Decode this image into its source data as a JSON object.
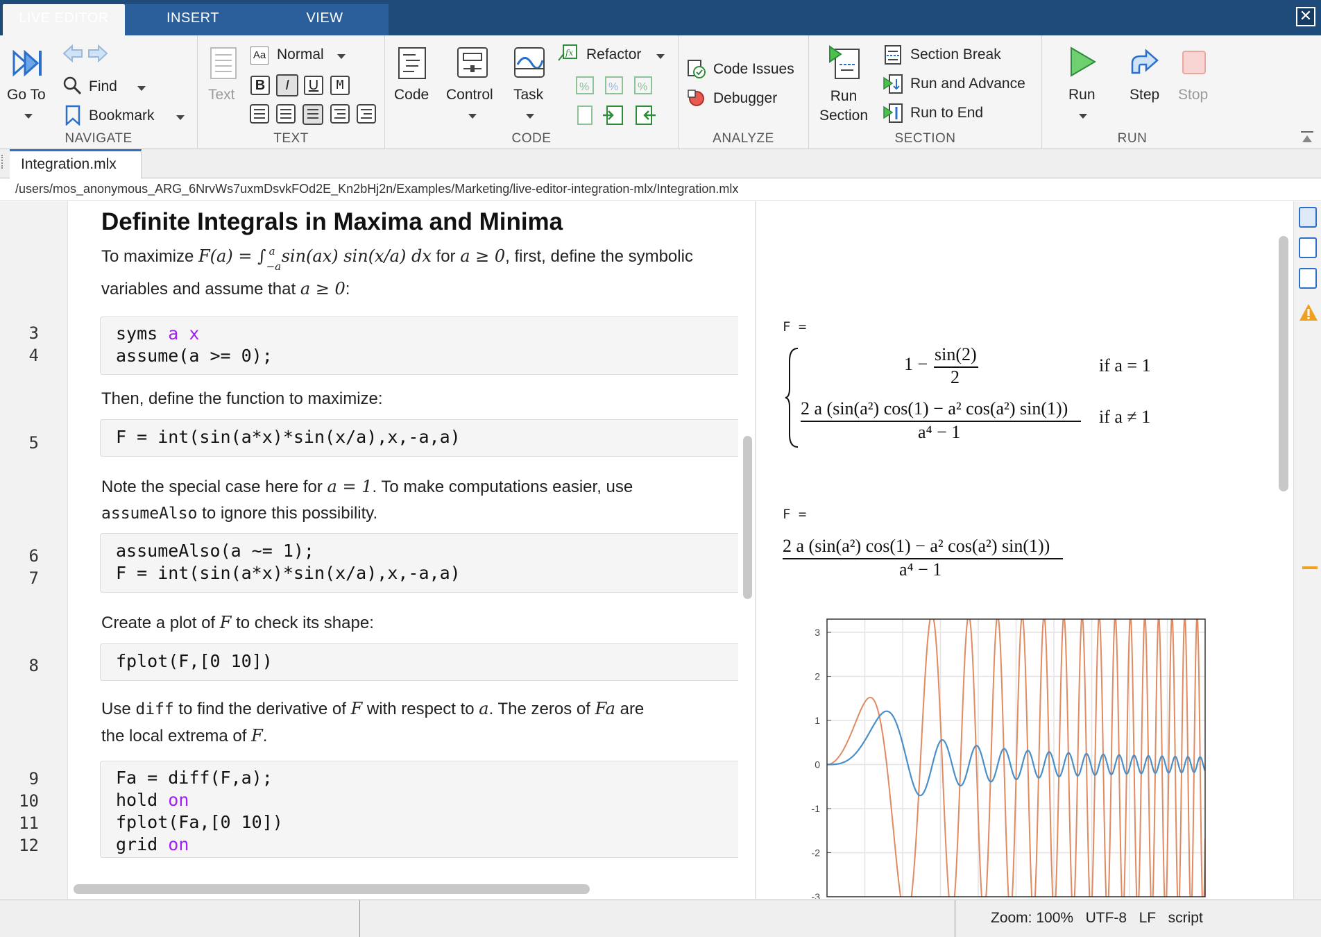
{
  "tabs": {
    "live_editor": "LIVE EDITOR",
    "insert": "INSERT",
    "view": "VIEW"
  },
  "ribbon": {
    "navigate": {
      "title": "NAVIGATE",
      "goto": "Go To",
      "find": "Find",
      "bookmark": "Bookmark"
    },
    "text": {
      "title": "TEXT",
      "text_btn": "Text",
      "style": "Normal",
      "bold": "B",
      "italic": "I",
      "underline": "U",
      "mono": "M"
    },
    "code": {
      "title": "CODE",
      "code_btn": "Code",
      "control": "Control",
      "task": "Task",
      "refactor": "Refactor"
    },
    "analyze": {
      "title": "ANALYZE",
      "code_issues": "Code Issues",
      "debugger": "Debugger"
    },
    "section": {
      "title": "SECTION",
      "run_section_1": "Run",
      "run_section_2": "Section",
      "section_break": "Section Break",
      "run_advance": "Run and Advance",
      "run_to_end": "Run to End"
    },
    "run": {
      "title": "RUN",
      "run": "Run",
      "step": "Step",
      "stop": "Stop"
    }
  },
  "document": {
    "tab_name": "Integration.mlx",
    "path": "/users/mos_anonymous_ARG_6NrvWs7uxmDsvkFOd2E_Kn2bHj2n/Examples/Marketing/live-editor-integration-mlx/Integration.mlx"
  },
  "editor": {
    "heading": "Definite Integrals in Maxima and Minima",
    "p1_a": "To maximize ",
    "p1_math1": "F(a) = ∫",
    "p1_sup": "a",
    "p1_sub": "−a",
    "p1_math2": "sin(ax) sin(x/a) dx",
    "p1_b": " for ",
    "p1_math3": "a ≥ 0",
    "p1_c": ", first, define the symbolic",
    "p1_line2": "variables and assume that ",
    "p1_math4": "a ≥ 0",
    "p1_end": ":",
    "p2": "Then, define the function to maximize:",
    "p3_a": "Note the special case here for ",
    "p3_math": "a = 1",
    "p3_b": ". To make computations easier, use",
    "p3_code": "assumeAlso",
    "p3_c": " to ignore this possibility.",
    "p4_a": "Create a plot of ",
    "p4_math": "F",
    "p4_b": " to check its shape:",
    "p5_a": "Use ",
    "p5_code": "diff",
    "p5_b": " to find the derivative of ",
    "p5_math1": "F",
    "p5_c": " with respect to ",
    "p5_math2": "a",
    "p5_d": ". The zeros of ",
    "p5_math3": "Fa",
    "p5_e": " are",
    "p5_line2": "the local extrema of ",
    "p5_math4": "F",
    "p5_end": ".",
    "blocks": [
      {
        "lines": [
          {
            "n": "3",
            "plain": "syms ",
            "kw": "a x"
          },
          {
            "n": "4",
            "plain": "assume(a >= 0);",
            "kw": ""
          }
        ]
      },
      {
        "lines": [
          {
            "n": "5",
            "plain": "F = int(sin(a*x)*sin(x/a),x,-a,a)",
            "kw": ""
          }
        ]
      },
      {
        "lines": [
          {
            "n": "6",
            "plain": "assumeAlso(a ~= 1);",
            "kw": ""
          },
          {
            "n": "7",
            "plain": "F = int(sin(a*x)*sin(x/a),x,-a,a)",
            "kw": ""
          }
        ]
      },
      {
        "lines": [
          {
            "n": "8",
            "plain": "fplot(F,[0 10])",
            "kw": ""
          }
        ]
      },
      {
        "lines": [
          {
            "n": "9",
            "plain": "Fa = diff(F,a);",
            "kw": ""
          },
          {
            "n": "10",
            "plain": "hold ",
            "kw": "on"
          },
          {
            "n": "11",
            "plain": "fplot(Fa,[0 10])",
            "kw": ""
          },
          {
            "n": "12",
            "plain": "grid ",
            "kw": "on"
          }
        ]
      }
    ]
  },
  "output": {
    "label1": "F =",
    "case1_expr_a": "1 − ",
    "case1_num": "sin(2)",
    "case1_den": "2",
    "case1_cond": "if  a = 1",
    "case2_num": "2 a  (sin(a²) cos(1) − a² cos(a²) sin(1))",
    "case2_den": "a⁴ − 1",
    "case2_cond": "if  a ≠ 1",
    "label2": "F =",
    "expr2_num": "2 a  (sin(a²) cos(1) − a² cos(a²) sin(1))",
    "expr2_den": "a⁴ − 1"
  },
  "chart_data": {
    "type": "line",
    "xlim": [
      0,
      10
    ],
    "ylim": [
      -3,
      3.3
    ],
    "yticks": [
      "3",
      "2",
      "1",
      "0",
      "-1",
      "-2",
      "-3"
    ],
    "grid": true,
    "series_colors": {
      "F": "#4a8fc7",
      "Fa": "#e08a62"
    }
  },
  "status": {
    "zoom": "Zoom: 100%",
    "encoding": "UTF-8",
    "eol": "LF",
    "type": "script"
  }
}
